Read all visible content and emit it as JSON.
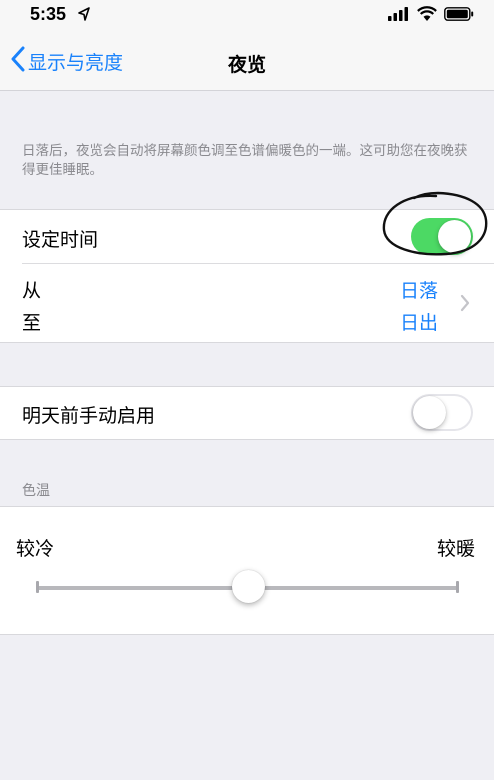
{
  "status_bar": {
    "time": "5:35",
    "location_icon": "location-arrow-icon",
    "signal_icon": "cellular-signal-icon",
    "wifi_icon": "wifi-icon",
    "battery_icon": "battery-icon"
  },
  "nav": {
    "back_label": "显示与亮度",
    "title": "夜览",
    "accent_color": "#1a82fb"
  },
  "description": "日落后，夜览会自动将屏幕颜色调至色谱偏暖色的一端。这可助您在夜晚获得更佳睡眠。",
  "schedule": {
    "label": "设定时间",
    "enabled": true,
    "from_label": "从",
    "to_label": "至",
    "from_value": "日落",
    "to_value": "日出",
    "toggle_color": "#4cd964"
  },
  "manual": {
    "label": "明天前手动启用",
    "enabled": false
  },
  "color_temperature": {
    "section_title": "色温",
    "min_label": "较冷",
    "max_label": "较暖",
    "value": 0.5
  }
}
